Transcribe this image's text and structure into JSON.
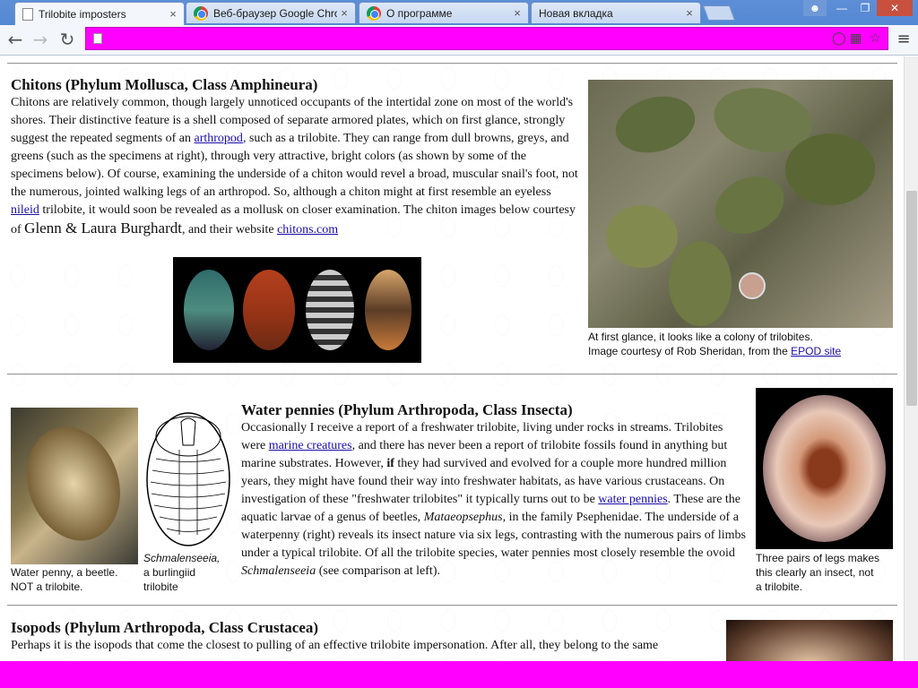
{
  "browser": {
    "tabs": [
      {
        "title": "Trilobite imposters",
        "active": true,
        "favicon": "page"
      },
      {
        "title": "Веб-браузер Google Chrome",
        "active": false,
        "favicon": "chrome"
      },
      {
        "title": "О программе",
        "active": false,
        "favicon": "chrome"
      },
      {
        "title": "Новая вкладка",
        "active": false,
        "favicon": "none"
      }
    ],
    "close_glyph": "×",
    "address": ""
  },
  "page": {
    "chitons": {
      "heading": "Chitons (Phylum Mollusca, Class Amphineura)",
      "t1": "Chitons are relatively common, though largely unnoticed occupants of the intertidal zone on most of the world's shores. Their distinctive feature is a shell composed of separate armored plates, which on first glance, strongly suggest the repeated segments of an ",
      "link1": "arthropod",
      "t2": ", such as a trilobite. They can range from dull browns, greys, and greens (such as the specimens at right), through very attractive, bright colors (as shown by some of the specimens below). Of course, examining the underside of a chiton would revel a broad, muscular snail's foot, not the numerous, jointed walking legs of an arthropod. So, although a chiton might at first resemble an eyeless ",
      "link2": "nileid",
      "t3": " trilobite, it would soon be revealed as a mollusk on closer examination. The chiton images below courtesy of ",
      "credit": "Glenn & Laura Burghardt",
      "t4": ", and their website ",
      "link3": "chitons.com",
      "photo_caption_1": "At first glance, it looks like a colony of trilobites.",
      "photo_caption_2": "Image courtesy of Rob Sheridan, from the ",
      "photo_link": "EPOD site"
    },
    "pennies": {
      "heading": "Water pennies (Phylum Arthropoda, Class Insecta)",
      "t1": "Occasionally I receive a report of a freshwater trilobite, living under rocks in streams. Trilobites were ",
      "link1": "marine creatures",
      "t2": ", and there has never been a report of trilobite fossils found in anything but marine substrates. However, ",
      "bold": "if",
      "t3": " they had survived and evolved for a couple more hundred million years, they might have found their way into freshwater habitats, as have various crustaceans. On investigation of these \"freshwater trilobites\" it typically turns out to be ",
      "link2": "water pennies",
      "t4": ". These are the aquatic larvae of a genus of beetles, ",
      "genus": "Mataeopsephus,",
      "t5": " in the family Psephenidae. The underside of a waterpenny (right) reveals its insect nature via six legs, contrasting with the numerous pairs of limbs under a typical trilobite. Of all the trilobite species, water pennies most closely resemble the ovoid ",
      "genus2": "Schmalenseeia",
      "t6": " (see comparison at left).",
      "cap_left_1": "Water penny, a beetle.",
      "cap_left_2": "NOT a trilobite.",
      "cap_mid_1": "Schmalenseeia,",
      "cap_mid_2": "a burlingiid",
      "cap_mid_3": "trilobite",
      "cap_right_1": "Three pairs of legs makes",
      "cap_right_2": "this clearly an insect, not",
      "cap_right_3": "a trilobite."
    },
    "isopods": {
      "heading": "Isopods (Phylum Arthropoda, Class Crustacea)",
      "t1": "Perhaps it is the isopods that come the closest to pulling of an effective trilobite impersonation. After all, they belong to the same"
    }
  },
  "colors": {
    "accent": "#ff00ff",
    "link": "#1a0dab",
    "frame": "#4a7fcf"
  }
}
